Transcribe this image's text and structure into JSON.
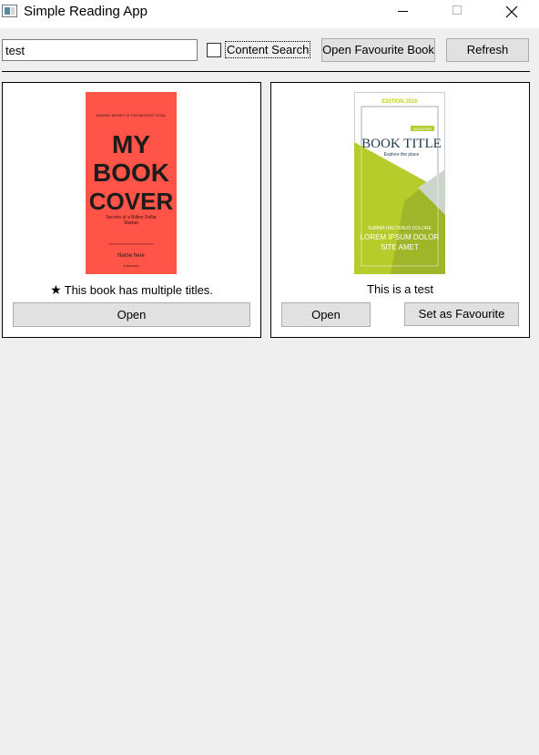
{
  "window": {
    "title": "Simple Reading App"
  },
  "toolbar": {
    "search_value": "test",
    "content_search_label": "Content Search",
    "content_search_checked": false,
    "open_favourite_label": "Open Favourite Book",
    "refresh_label": "Refresh"
  },
  "books": [
    {
      "cover": {
        "top_line": "MAKING MONEY IS THE BIGGEST GOAL",
        "title_line1": "MY",
        "title_line2": "BOOK",
        "title_line3": "COVER",
        "subtitle": "Secrets of a Billion Dollar Startup",
        "author": "Name here",
        "bottom_line": "PUBLISHER",
        "bg_color": "#ff5447"
      },
      "caption": "This book has multiple titles.",
      "has_star": true,
      "open_label": "Open"
    },
    {
      "cover": {
        "edition": "EDITION 2020",
        "badge": "MAGAZINE",
        "title": "BOOK TITLE",
        "subtitle": "Explore the place",
        "tagline": "SUMMA HACTENUS DOLORE",
        "lorem_line1": "LOREM IPSUM DOLOR",
        "lorem_line2": "SITE AMET",
        "accent_color": "#b5cc2a",
        "dark_color": "#9fb52a"
      },
      "caption": "This is a test",
      "has_star": false,
      "open_label": "Open",
      "set_favourite_label": "Set as Favourite"
    }
  ]
}
